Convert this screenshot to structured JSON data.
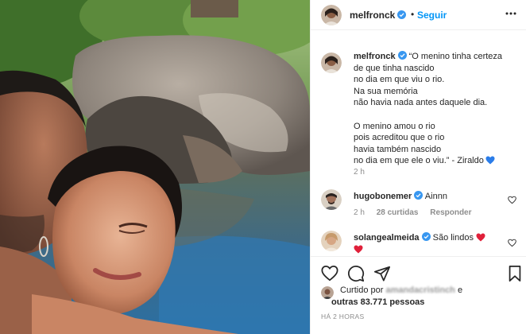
{
  "post": {
    "author": "melfronck",
    "verified": true,
    "follow_label": "Seguir",
    "separator": "•",
    "more_icon": "ellipsis-horizontal-icon"
  },
  "caption": {
    "author": "melfronck",
    "lines": [
      "“O menino tinha certeza",
      "de que tinha nascido",
      "no dia em que viu o rio.",
      "Na sua memória",
      "não havia nada antes daquele dia.",
      "",
      "O menino amou o rio",
      "pois acreditou que o rio",
      "havia também nascido",
      "no dia em que ele o viu.” - Ziraldo"
    ],
    "emoji": "blue-heart",
    "timestamp": "2 h"
  },
  "comments": [
    {
      "author": "hugobonemer",
      "verified": true,
      "text": "Ainnn",
      "time": "2 h",
      "likes": "28 curtidas",
      "reply_label": "Responder"
    },
    {
      "author": "solangealmeida",
      "verified": true,
      "text": "São lindos",
      "emoji": "red-heart"
    }
  ],
  "actions": {
    "like_icon": "heart-outline-icon",
    "comment_icon": "comment-bubble-icon",
    "share_icon": "paper-plane-icon",
    "save_icon": "bookmark-icon"
  },
  "likes": {
    "prefix": "Curtido por",
    "liker": "amandacristinch",
    "conjunction": "e",
    "others": "outras 83.771 pessoas"
  },
  "posted_ago": "HÁ 2 HORAS",
  "colors": {
    "accent_blue": "#0095f6",
    "verified_blue": "#3897f0",
    "heart_red": "#ed4956",
    "muted_text": "#8e8e8e"
  }
}
